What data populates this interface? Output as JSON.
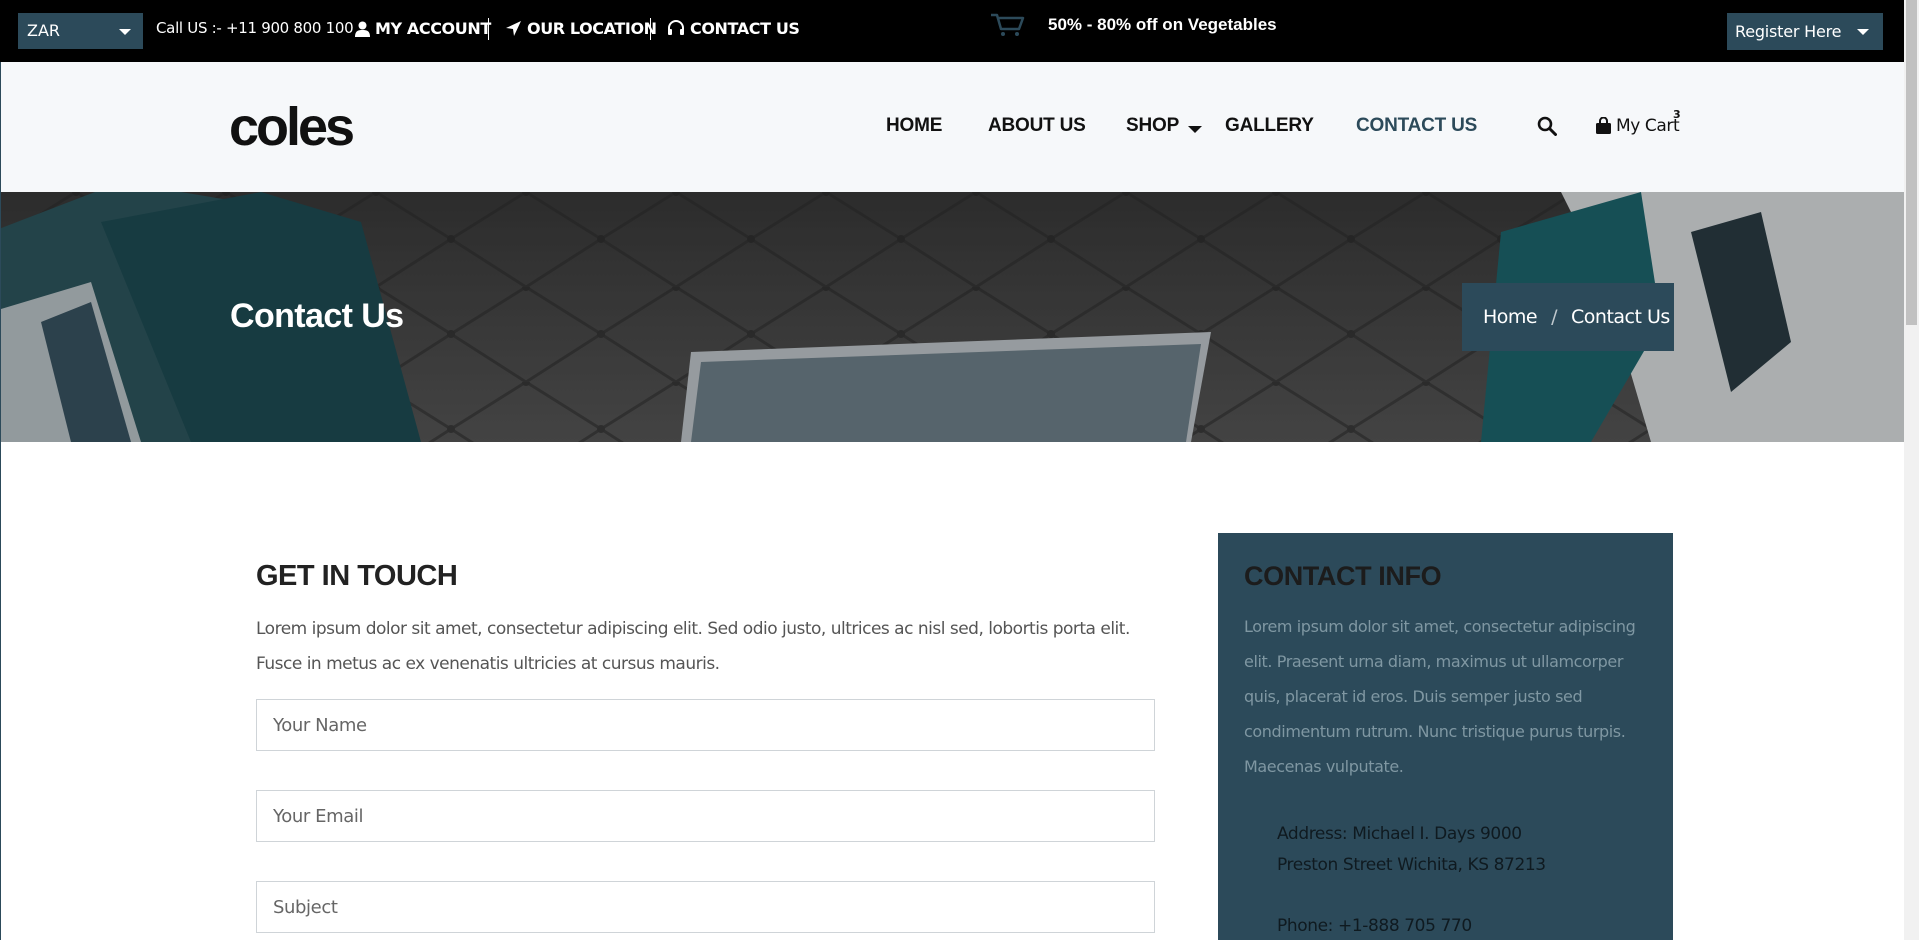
{
  "topbar": {
    "currency": "ZAR",
    "call": "Call US :- +11 900 800 100",
    "my_account": "MY ACCOUNT",
    "our_location": "OUR LOCATION",
    "contact_us": "CONTACT US",
    "promo": "50% - 80% off on Vegetables",
    "register": "Register Here"
  },
  "header": {
    "logo": "coles",
    "nav": [
      "HOME",
      "ABOUT US",
      "SHOP",
      "GALLERY",
      "CONTACT US"
    ],
    "active_nav": "CONTACT US",
    "cart_label": "My Cart",
    "cart_count": "3"
  },
  "banner": {
    "title": "Contact Us",
    "breadcrumb": [
      "Home",
      "Contact Us"
    ]
  },
  "get_in_touch": {
    "title": "GET IN TOUCH",
    "description": "Lorem ipsum dolor sit amet, consectetur adipiscing elit. Sed odio justo, ultrices ac nisl sed, lobortis porta elit. Fusce in metus ac ex venenatis ultricies at cursus mauris.",
    "fields": [
      {
        "placeholder": "Your Name",
        "value": ""
      },
      {
        "placeholder": "Your Email",
        "value": ""
      },
      {
        "placeholder": "Subject",
        "value": ""
      }
    ]
  },
  "contact_info": {
    "title": "CONTACT INFO",
    "description": "Lorem ipsum dolor sit amet, consectetur adipiscing elit. Praesent urna diam, maximus ut ullamcorper quis, placerat id eros. Duis semper justo sed condimentum rutrum. Nunc tristique purus turpis. Maecenas vulputate.",
    "address": "Address: Michael I. Days 9000 Preston Street Wichita, KS 87213",
    "phone": "Phone: +1-888 705 770"
  },
  "colors": {
    "accent": "#2c4a5a",
    "topbar_bg": "#000000",
    "header_bg": "#f6f8fa"
  },
  "icons": [
    "user-icon",
    "location-arrow-icon",
    "headset-icon",
    "cart-outline-icon",
    "search-icon",
    "shopping-bag-icon"
  ]
}
